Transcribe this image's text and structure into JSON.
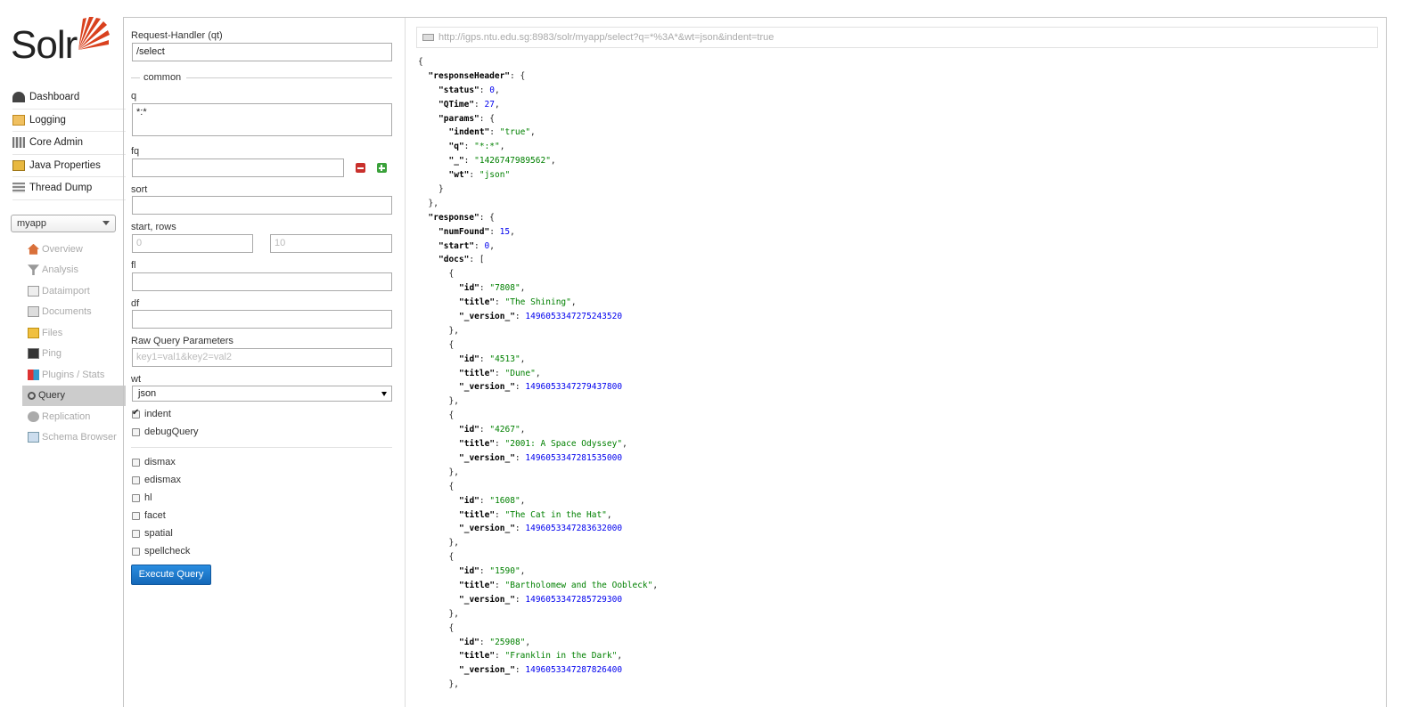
{
  "logo_text": "Solr",
  "main_menu": [
    {
      "label": "Dashboard",
      "icon": "dashboard-icon"
    },
    {
      "label": "Logging",
      "icon": "logging-icon"
    },
    {
      "label": "Core Admin",
      "icon": "core-admin-icon"
    },
    {
      "label": "Java Properties",
      "icon": "java-properties-icon"
    },
    {
      "label": "Thread Dump",
      "icon": "thread-dump-icon"
    }
  ],
  "core_selector": {
    "value": "myapp"
  },
  "core_menu": [
    {
      "label": "Overview",
      "icon": "home-icon",
      "active": false
    },
    {
      "label": "Analysis",
      "icon": "funnel-icon",
      "active": false
    },
    {
      "label": "Dataimport",
      "icon": "dataimport-icon",
      "active": false
    },
    {
      "label": "Documents",
      "icon": "documents-icon",
      "active": false
    },
    {
      "label": "Files",
      "icon": "files-icon",
      "active": false
    },
    {
      "label": "Ping",
      "icon": "ping-icon",
      "active": false
    },
    {
      "label": "Plugins / Stats",
      "icon": "plugins-icon",
      "active": false
    },
    {
      "label": "Query",
      "icon": "query-icon",
      "active": true
    },
    {
      "label": "Replication",
      "icon": "replication-icon",
      "active": false
    },
    {
      "label": "Schema Browser",
      "icon": "schema-browser-icon",
      "active": false
    }
  ],
  "form": {
    "qt_label": "Request-Handler (qt)",
    "qt_value": "/select",
    "common_legend": "common",
    "q_label": "q",
    "q_value": "*:*",
    "fq_label": "fq",
    "fq_value": "",
    "sort_label": "sort",
    "sort_value": "",
    "start_rows_label": "start, rows",
    "start_placeholder": "0",
    "rows_placeholder": "10",
    "fl_label": "fl",
    "fl_value": "",
    "df_label": "df",
    "df_value": "",
    "raw_label": "Raw Query Parameters",
    "raw_placeholder": "key1=val1&key2=val2",
    "wt_label": "wt",
    "wt_value": "json",
    "indent_label": "indent",
    "indent_checked": true,
    "debug_label": "debugQuery",
    "debug_checked": false,
    "extras": [
      {
        "label": "dismax",
        "checked": false
      },
      {
        "label": "edismax",
        "checked": false
      },
      {
        "label": "hl",
        "checked": false
      },
      {
        "label": "facet",
        "checked": false
      },
      {
        "label": "spatial",
        "checked": false
      },
      {
        "label": "spellcheck",
        "checked": false
      }
    ],
    "execute_label": "Execute Query"
  },
  "result": {
    "url": "http://igps.ntu.edu.sg:8983/solr/myapp/select?q=*%3A*&wt=json&indent=true",
    "lines": [
      {
        "indent": 0,
        "parts": [
          [
            "p",
            "{"
          ]
        ]
      },
      {
        "indent": 1,
        "parts": [
          [
            "k",
            "\"responseHeader\""
          ],
          [
            "p",
            ": {"
          ]
        ]
      },
      {
        "indent": 2,
        "parts": [
          [
            "k",
            "\"status\""
          ],
          [
            "p",
            ": "
          ],
          [
            "n",
            "0"
          ],
          [
            "p",
            ","
          ]
        ]
      },
      {
        "indent": 2,
        "parts": [
          [
            "k",
            "\"QTime\""
          ],
          [
            "p",
            ": "
          ],
          [
            "n",
            "27"
          ],
          [
            "p",
            ","
          ]
        ]
      },
      {
        "indent": 2,
        "parts": [
          [
            "k",
            "\"params\""
          ],
          [
            "p",
            ": {"
          ]
        ]
      },
      {
        "indent": 3,
        "parts": [
          [
            "k",
            "\"indent\""
          ],
          [
            "p",
            ": "
          ],
          [
            "s",
            "\"true\""
          ],
          [
            "p",
            ","
          ]
        ]
      },
      {
        "indent": 3,
        "parts": [
          [
            "k",
            "\"q\""
          ],
          [
            "p",
            ": "
          ],
          [
            "s",
            "\"*:*\""
          ],
          [
            "p",
            ","
          ]
        ]
      },
      {
        "indent": 3,
        "parts": [
          [
            "k",
            "\"_\""
          ],
          [
            "p",
            ": "
          ],
          [
            "s",
            "\"1426747989562\""
          ],
          [
            "p",
            ","
          ]
        ]
      },
      {
        "indent": 3,
        "parts": [
          [
            "k",
            "\"wt\""
          ],
          [
            "p",
            ": "
          ],
          [
            "s",
            "\"json\""
          ]
        ]
      },
      {
        "indent": 2,
        "parts": [
          [
            "p",
            "}"
          ]
        ]
      },
      {
        "indent": 1,
        "parts": [
          [
            "p",
            "},"
          ]
        ]
      },
      {
        "indent": 1,
        "parts": [
          [
            "k",
            "\"response\""
          ],
          [
            "p",
            ": {"
          ]
        ]
      },
      {
        "indent": 2,
        "parts": [
          [
            "k",
            "\"numFound\""
          ],
          [
            "p",
            ": "
          ],
          [
            "n",
            "15"
          ],
          [
            "p",
            ","
          ]
        ]
      },
      {
        "indent": 2,
        "parts": [
          [
            "k",
            "\"start\""
          ],
          [
            "p",
            ": "
          ],
          [
            "n",
            "0"
          ],
          [
            "p",
            ","
          ]
        ]
      },
      {
        "indent": 2,
        "parts": [
          [
            "k",
            "\"docs\""
          ],
          [
            "p",
            ": ["
          ]
        ]
      },
      {
        "indent": 3,
        "parts": [
          [
            "p",
            "{"
          ]
        ]
      },
      {
        "indent": 4,
        "parts": [
          [
            "k",
            "\"id\""
          ],
          [
            "p",
            ": "
          ],
          [
            "s",
            "\"7808\""
          ],
          [
            "p",
            ","
          ]
        ]
      },
      {
        "indent": 4,
        "parts": [
          [
            "k",
            "\"title\""
          ],
          [
            "p",
            ": "
          ],
          [
            "s",
            "\"The Shining\""
          ],
          [
            "p",
            ","
          ]
        ]
      },
      {
        "indent": 4,
        "parts": [
          [
            "k",
            "\"_version_\""
          ],
          [
            "p",
            ": "
          ],
          [
            "n",
            "1496053347275243520"
          ]
        ]
      },
      {
        "indent": 3,
        "parts": [
          [
            "p",
            "},"
          ]
        ]
      },
      {
        "indent": 3,
        "parts": [
          [
            "p",
            "{"
          ]
        ]
      },
      {
        "indent": 4,
        "parts": [
          [
            "k",
            "\"id\""
          ],
          [
            "p",
            ": "
          ],
          [
            "s",
            "\"4513\""
          ],
          [
            "p",
            ","
          ]
        ]
      },
      {
        "indent": 4,
        "parts": [
          [
            "k",
            "\"title\""
          ],
          [
            "p",
            ": "
          ],
          [
            "s",
            "\"Dune\""
          ],
          [
            "p",
            ","
          ]
        ]
      },
      {
        "indent": 4,
        "parts": [
          [
            "k",
            "\"_version_\""
          ],
          [
            "p",
            ": "
          ],
          [
            "n",
            "1496053347279437800"
          ]
        ]
      },
      {
        "indent": 3,
        "parts": [
          [
            "p",
            "},"
          ]
        ]
      },
      {
        "indent": 3,
        "parts": [
          [
            "p",
            "{"
          ]
        ]
      },
      {
        "indent": 4,
        "parts": [
          [
            "k",
            "\"id\""
          ],
          [
            "p",
            ": "
          ],
          [
            "s",
            "\"4267\""
          ],
          [
            "p",
            ","
          ]
        ]
      },
      {
        "indent": 4,
        "parts": [
          [
            "k",
            "\"title\""
          ],
          [
            "p",
            ": "
          ],
          [
            "s",
            "\"2001: A Space Odyssey\""
          ],
          [
            "p",
            ","
          ]
        ]
      },
      {
        "indent": 4,
        "parts": [
          [
            "k",
            "\"_version_\""
          ],
          [
            "p",
            ": "
          ],
          [
            "n",
            "1496053347281535000"
          ]
        ]
      },
      {
        "indent": 3,
        "parts": [
          [
            "p",
            "},"
          ]
        ]
      },
      {
        "indent": 3,
        "parts": [
          [
            "p",
            "{"
          ]
        ]
      },
      {
        "indent": 4,
        "parts": [
          [
            "k",
            "\"id\""
          ],
          [
            "p",
            ": "
          ],
          [
            "s",
            "\"1608\""
          ],
          [
            "p",
            ","
          ]
        ]
      },
      {
        "indent": 4,
        "parts": [
          [
            "k",
            "\"title\""
          ],
          [
            "p",
            ": "
          ],
          [
            "s",
            "\"The Cat in the Hat\""
          ],
          [
            "p",
            ","
          ]
        ]
      },
      {
        "indent": 4,
        "parts": [
          [
            "k",
            "\"_version_\""
          ],
          [
            "p",
            ": "
          ],
          [
            "n",
            "1496053347283632000"
          ]
        ]
      },
      {
        "indent": 3,
        "parts": [
          [
            "p",
            "},"
          ]
        ]
      },
      {
        "indent": 3,
        "parts": [
          [
            "p",
            "{"
          ]
        ]
      },
      {
        "indent": 4,
        "parts": [
          [
            "k",
            "\"id\""
          ],
          [
            "p",
            ": "
          ],
          [
            "s",
            "\"1590\""
          ],
          [
            "p",
            ","
          ]
        ]
      },
      {
        "indent": 4,
        "parts": [
          [
            "k",
            "\"title\""
          ],
          [
            "p",
            ": "
          ],
          [
            "s",
            "\"Bartholomew and the Oobleck\""
          ],
          [
            "p",
            ","
          ]
        ]
      },
      {
        "indent": 4,
        "parts": [
          [
            "k",
            "\"_version_\""
          ],
          [
            "p",
            ": "
          ],
          [
            "n",
            "1496053347285729300"
          ]
        ]
      },
      {
        "indent": 3,
        "parts": [
          [
            "p",
            "},"
          ]
        ]
      },
      {
        "indent": 3,
        "parts": [
          [
            "p",
            "{"
          ]
        ]
      },
      {
        "indent": 4,
        "parts": [
          [
            "k",
            "\"id\""
          ],
          [
            "p",
            ": "
          ],
          [
            "s",
            "\"25908\""
          ],
          [
            "p",
            ","
          ]
        ]
      },
      {
        "indent": 4,
        "parts": [
          [
            "k",
            "\"title\""
          ],
          [
            "p",
            ": "
          ],
          [
            "s",
            "\"Franklin in the Dark\""
          ],
          [
            "p",
            ","
          ]
        ]
      },
      {
        "indent": 4,
        "parts": [
          [
            "k",
            "\"_version_\""
          ],
          [
            "p",
            ": "
          ],
          [
            "n",
            "1496053347287826400"
          ]
        ]
      },
      {
        "indent": 3,
        "parts": [
          [
            "p",
            "},"
          ]
        ]
      }
    ]
  }
}
